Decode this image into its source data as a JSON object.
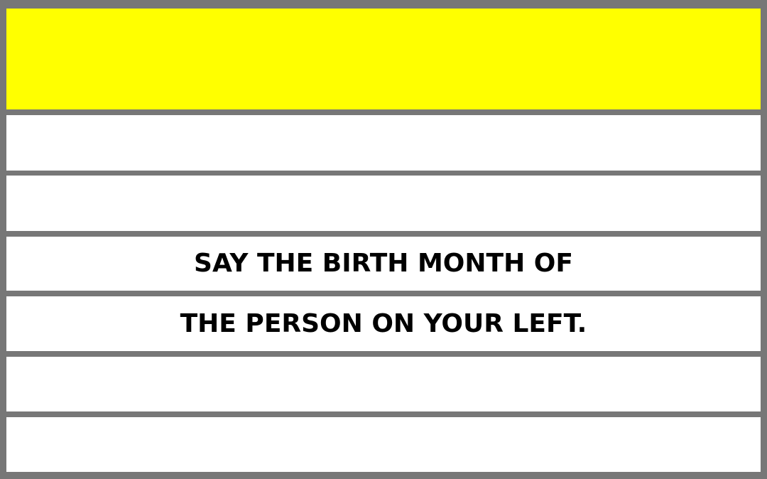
{
  "card": {
    "colors": {
      "frame": "#777777",
      "header": "#ffff00",
      "row": "#ffffff",
      "text": "#000000"
    },
    "lines": [
      "",
      "",
      "SAY THE BIRTH MONTH OF",
      "THE PERSON ON YOUR LEFT.",
      "",
      ""
    ]
  }
}
